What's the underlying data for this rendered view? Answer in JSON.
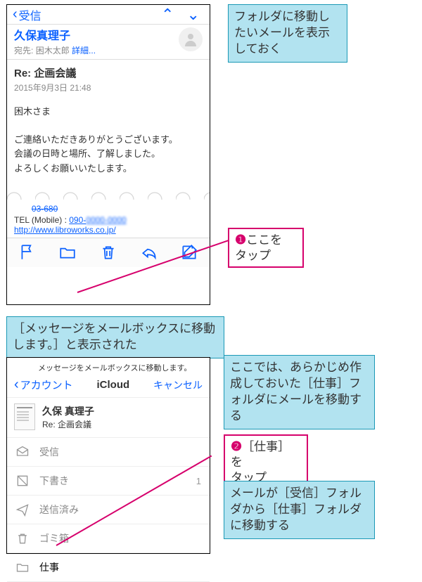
{
  "phone1": {
    "back_label": "受信",
    "nav_up": "⌃",
    "nav_down": "⌄",
    "sender": "久保真理子",
    "recipient_prefix": "宛先:",
    "recipient_name": "困木太郎",
    "details": "詳細...",
    "subject": "Re: 企画会議",
    "date": "2015年9月3日 21:48",
    "body_lines": [
      "困木さま",
      "",
      "ご連絡いただきありがとうございます。",
      "会議の日時と場所、了解しました。",
      "よろしくお願いいたします。"
    ],
    "sig_tel_label": "TEL (Mobile) :",
    "sig_tel_partial_prefix": "03-680",
    "sig_tel_num": "090-",
    "sig_url": "http://www.libroworks.co.jp/"
  },
  "phone2": {
    "hint": "メッセージをメールボックスに移動します。",
    "back": "アカウント",
    "title": "iCloud",
    "cancel": "キャンセル",
    "card_name": "久保 真理子",
    "card_subject": "Re: 企画会議",
    "folders": [
      {
        "label": "受信"
      },
      {
        "label": "下書き",
        "count": "1"
      },
      {
        "label": "送信済み"
      },
      {
        "label": "ゴミ箱"
      },
      {
        "label": "仕事",
        "active": true
      }
    ]
  },
  "callouts": {
    "c1": "フォルダに移動したいメールを表示しておく",
    "step1_num": "❶",
    "step1_text": "ここを\nタップ",
    "banner": "［メッセージをメールボックスに移動します。］と表示された",
    "c2": "ここでは、あらかじめ作成しておいた［仕事］フォルダにメールを移動する",
    "step2_num": "❷",
    "step2_text": "［仕事］を\nタップ",
    "c3": "メールが［受信］フォルダから［仕事］フォルダに移動する"
  }
}
